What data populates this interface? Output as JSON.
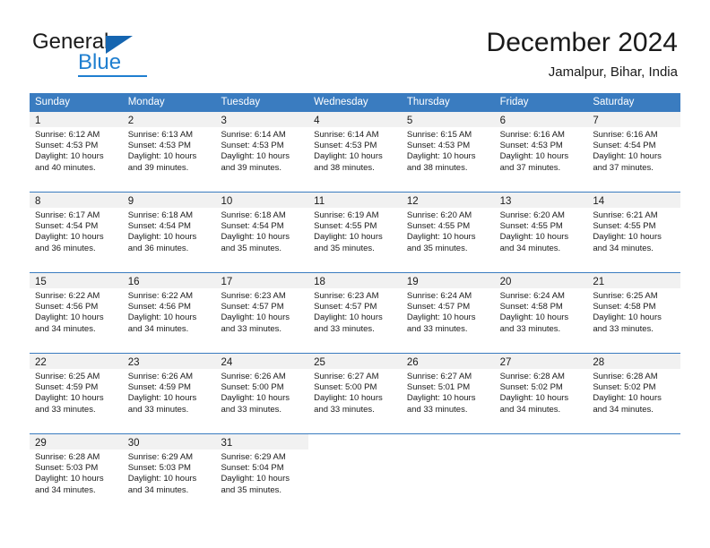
{
  "brand": {
    "name_part1": "General",
    "name_part2": "Blue",
    "triangle_color": "#1565b0",
    "blue_color": "#1f7fd0"
  },
  "header": {
    "title": "December 2024",
    "location": "Jamalpur, Bihar, India"
  },
  "theme": {
    "header_blue": "#3a7cc0",
    "daynum_band": "#f1f1f1",
    "text": "#1a1a1a"
  },
  "weekdays": [
    "Sunday",
    "Monday",
    "Tuesday",
    "Wednesday",
    "Thursday",
    "Friday",
    "Saturday"
  ],
  "weeks": [
    [
      {
        "day": "1",
        "sunrise": "Sunrise: 6:12 AM",
        "sunset": "Sunset: 4:53 PM",
        "daylight1": "Daylight: 10 hours",
        "daylight2": "and 40 minutes."
      },
      {
        "day": "2",
        "sunrise": "Sunrise: 6:13 AM",
        "sunset": "Sunset: 4:53 PM",
        "daylight1": "Daylight: 10 hours",
        "daylight2": "and 39 minutes."
      },
      {
        "day": "3",
        "sunrise": "Sunrise: 6:14 AM",
        "sunset": "Sunset: 4:53 PM",
        "daylight1": "Daylight: 10 hours",
        "daylight2": "and 39 minutes."
      },
      {
        "day": "4",
        "sunrise": "Sunrise: 6:14 AM",
        "sunset": "Sunset: 4:53 PM",
        "daylight1": "Daylight: 10 hours",
        "daylight2": "and 38 minutes."
      },
      {
        "day": "5",
        "sunrise": "Sunrise: 6:15 AM",
        "sunset": "Sunset: 4:53 PM",
        "daylight1": "Daylight: 10 hours",
        "daylight2": "and 38 minutes."
      },
      {
        "day": "6",
        "sunrise": "Sunrise: 6:16 AM",
        "sunset": "Sunset: 4:53 PM",
        "daylight1": "Daylight: 10 hours",
        "daylight2": "and 37 minutes."
      },
      {
        "day": "7",
        "sunrise": "Sunrise: 6:16 AM",
        "sunset": "Sunset: 4:54 PM",
        "daylight1": "Daylight: 10 hours",
        "daylight2": "and 37 minutes."
      }
    ],
    [
      {
        "day": "8",
        "sunrise": "Sunrise: 6:17 AM",
        "sunset": "Sunset: 4:54 PM",
        "daylight1": "Daylight: 10 hours",
        "daylight2": "and 36 minutes."
      },
      {
        "day": "9",
        "sunrise": "Sunrise: 6:18 AM",
        "sunset": "Sunset: 4:54 PM",
        "daylight1": "Daylight: 10 hours",
        "daylight2": "and 36 minutes."
      },
      {
        "day": "10",
        "sunrise": "Sunrise: 6:18 AM",
        "sunset": "Sunset: 4:54 PM",
        "daylight1": "Daylight: 10 hours",
        "daylight2": "and 35 minutes."
      },
      {
        "day": "11",
        "sunrise": "Sunrise: 6:19 AM",
        "sunset": "Sunset: 4:55 PM",
        "daylight1": "Daylight: 10 hours",
        "daylight2": "and 35 minutes."
      },
      {
        "day": "12",
        "sunrise": "Sunrise: 6:20 AM",
        "sunset": "Sunset: 4:55 PM",
        "daylight1": "Daylight: 10 hours",
        "daylight2": "and 35 minutes."
      },
      {
        "day": "13",
        "sunrise": "Sunrise: 6:20 AM",
        "sunset": "Sunset: 4:55 PM",
        "daylight1": "Daylight: 10 hours",
        "daylight2": "and 34 minutes."
      },
      {
        "day": "14",
        "sunrise": "Sunrise: 6:21 AM",
        "sunset": "Sunset: 4:55 PM",
        "daylight1": "Daylight: 10 hours",
        "daylight2": "and 34 minutes."
      }
    ],
    [
      {
        "day": "15",
        "sunrise": "Sunrise: 6:22 AM",
        "sunset": "Sunset: 4:56 PM",
        "daylight1": "Daylight: 10 hours",
        "daylight2": "and 34 minutes."
      },
      {
        "day": "16",
        "sunrise": "Sunrise: 6:22 AM",
        "sunset": "Sunset: 4:56 PM",
        "daylight1": "Daylight: 10 hours",
        "daylight2": "and 34 minutes."
      },
      {
        "day": "17",
        "sunrise": "Sunrise: 6:23 AM",
        "sunset": "Sunset: 4:57 PM",
        "daylight1": "Daylight: 10 hours",
        "daylight2": "and 33 minutes."
      },
      {
        "day": "18",
        "sunrise": "Sunrise: 6:23 AM",
        "sunset": "Sunset: 4:57 PM",
        "daylight1": "Daylight: 10 hours",
        "daylight2": "and 33 minutes."
      },
      {
        "day": "19",
        "sunrise": "Sunrise: 6:24 AM",
        "sunset": "Sunset: 4:57 PM",
        "daylight1": "Daylight: 10 hours",
        "daylight2": "and 33 minutes."
      },
      {
        "day": "20",
        "sunrise": "Sunrise: 6:24 AM",
        "sunset": "Sunset: 4:58 PM",
        "daylight1": "Daylight: 10 hours",
        "daylight2": "and 33 minutes."
      },
      {
        "day": "21",
        "sunrise": "Sunrise: 6:25 AM",
        "sunset": "Sunset: 4:58 PM",
        "daylight1": "Daylight: 10 hours",
        "daylight2": "and 33 minutes."
      }
    ],
    [
      {
        "day": "22",
        "sunrise": "Sunrise: 6:25 AM",
        "sunset": "Sunset: 4:59 PM",
        "daylight1": "Daylight: 10 hours",
        "daylight2": "and 33 minutes."
      },
      {
        "day": "23",
        "sunrise": "Sunrise: 6:26 AM",
        "sunset": "Sunset: 4:59 PM",
        "daylight1": "Daylight: 10 hours",
        "daylight2": "and 33 minutes."
      },
      {
        "day": "24",
        "sunrise": "Sunrise: 6:26 AM",
        "sunset": "Sunset: 5:00 PM",
        "daylight1": "Daylight: 10 hours",
        "daylight2": "and 33 minutes."
      },
      {
        "day": "25",
        "sunrise": "Sunrise: 6:27 AM",
        "sunset": "Sunset: 5:00 PM",
        "daylight1": "Daylight: 10 hours",
        "daylight2": "and 33 minutes."
      },
      {
        "day": "26",
        "sunrise": "Sunrise: 6:27 AM",
        "sunset": "Sunset: 5:01 PM",
        "daylight1": "Daylight: 10 hours",
        "daylight2": "and 33 minutes."
      },
      {
        "day": "27",
        "sunrise": "Sunrise: 6:28 AM",
        "sunset": "Sunset: 5:02 PM",
        "daylight1": "Daylight: 10 hours",
        "daylight2": "and 34 minutes."
      },
      {
        "day": "28",
        "sunrise": "Sunrise: 6:28 AM",
        "sunset": "Sunset: 5:02 PM",
        "daylight1": "Daylight: 10 hours",
        "daylight2": "and 34 minutes."
      }
    ],
    [
      {
        "day": "29",
        "sunrise": "Sunrise: 6:28 AM",
        "sunset": "Sunset: 5:03 PM",
        "daylight1": "Daylight: 10 hours",
        "daylight2": "and 34 minutes."
      },
      {
        "day": "30",
        "sunrise": "Sunrise: 6:29 AM",
        "sunset": "Sunset: 5:03 PM",
        "daylight1": "Daylight: 10 hours",
        "daylight2": "and 34 minutes."
      },
      {
        "day": "31",
        "sunrise": "Sunrise: 6:29 AM",
        "sunset": "Sunset: 5:04 PM",
        "daylight1": "Daylight: 10 hours",
        "daylight2": "and 35 minutes."
      },
      {
        "day": "",
        "sunrise": "",
        "sunset": "",
        "daylight1": "",
        "daylight2": ""
      },
      {
        "day": "",
        "sunrise": "",
        "sunset": "",
        "daylight1": "",
        "daylight2": ""
      },
      {
        "day": "",
        "sunrise": "",
        "sunset": "",
        "daylight1": "",
        "daylight2": ""
      },
      {
        "day": "",
        "sunrise": "",
        "sunset": "",
        "daylight1": "",
        "daylight2": ""
      }
    ]
  ]
}
